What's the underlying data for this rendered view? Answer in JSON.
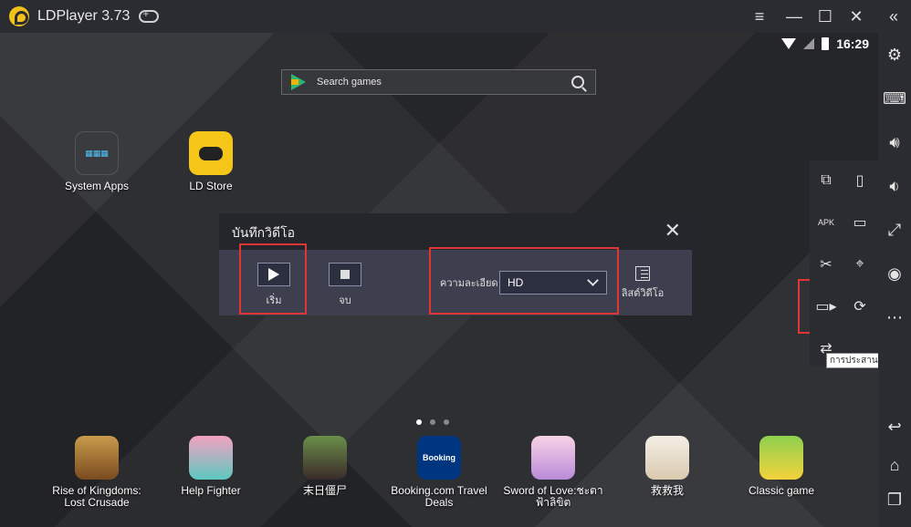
{
  "window": {
    "title": "LDPlayer 3.73"
  },
  "status": {
    "time": "16:29"
  },
  "search": {
    "placeholder": "Search games"
  },
  "desktop_apps": [
    {
      "label": "System Apps"
    },
    {
      "label": "LD Store"
    }
  ],
  "dock_apps": [
    {
      "label": "Rise of Kingdoms: Lost Crusade"
    },
    {
      "label": "Help Fighter"
    },
    {
      "label": "末日僵尸"
    },
    {
      "label": "Booking.com Travel Deals",
      "icon_text": "Booking"
    },
    {
      "label": "Sword of Love:ชะตาฟ้าลิขิต"
    },
    {
      "label": "救救我"
    },
    {
      "label": "Classic game"
    }
  ],
  "record_dialog": {
    "title": "บันทึกวิดีโอ",
    "start_label": "เริ่ม",
    "stop_label": "จบ",
    "resolution_label": "ความละเอียด",
    "resolution_value": "HD",
    "video_list_label": "ลิสต์วิดีโอ"
  },
  "tooltip": {
    "text": "การประสานงาน(ctrl"
  },
  "colors": {
    "accent": "#f2c21b",
    "highlight": "#e03535",
    "dialog_body": "#3d3f4f"
  }
}
